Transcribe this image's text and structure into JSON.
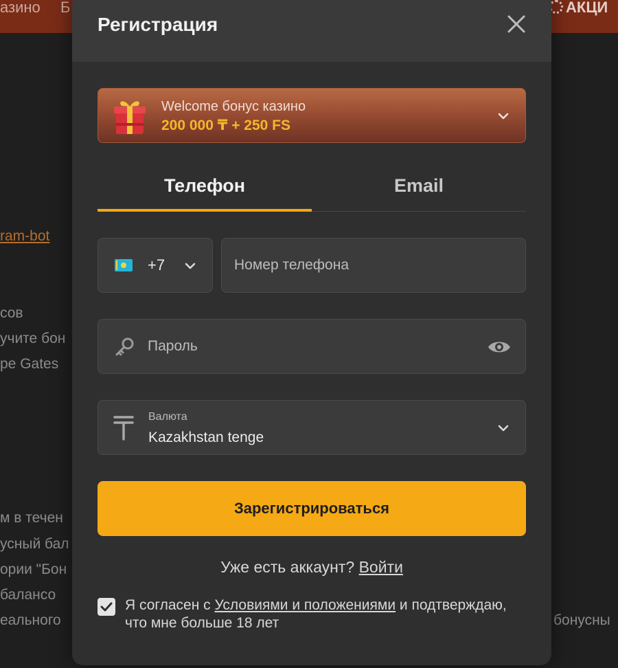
{
  "background": {
    "nav_left": "азино",
    "nav_b": "Б",
    "nav_right": "АКЦИ",
    "lines": [
      "ram-bot",
      "сов",
      "учите бон",
      "pe Gates",
      "м в течен",
      "усный бал",
      "ории \"Бон",
      " балансо",
      "еального",
      "бонусны"
    ]
  },
  "modal": {
    "title": "Регистрация",
    "bonus": {
      "title": "Welcome бонус казино",
      "amount": "200 000 ₸ + 250 FS"
    },
    "tabs": [
      {
        "label": "Телефон",
        "active": true
      },
      {
        "label": "Email",
        "active": false
      }
    ],
    "phone": {
      "code": "+7",
      "placeholder": "Номер телефона"
    },
    "password": {
      "placeholder": "Пароль"
    },
    "currency": {
      "label": "Валюта",
      "value": "Kazakhstan tenge"
    },
    "submit_label": "Зарегистрироваться",
    "login": {
      "question": "Уже есть аккаунт?",
      "link": "Войти"
    },
    "agree": {
      "checked": true,
      "text_before": "Я согласен с ",
      "link": "Условиями и положениями",
      "text_after": " и подтверждаю, что мне больше 18 лет"
    }
  },
  "colors": {
    "accent": "#f5a914",
    "bonus_amount": "#f6b629",
    "topbar": "#7a2c17",
    "modal_bg": "#2f2f2f"
  }
}
